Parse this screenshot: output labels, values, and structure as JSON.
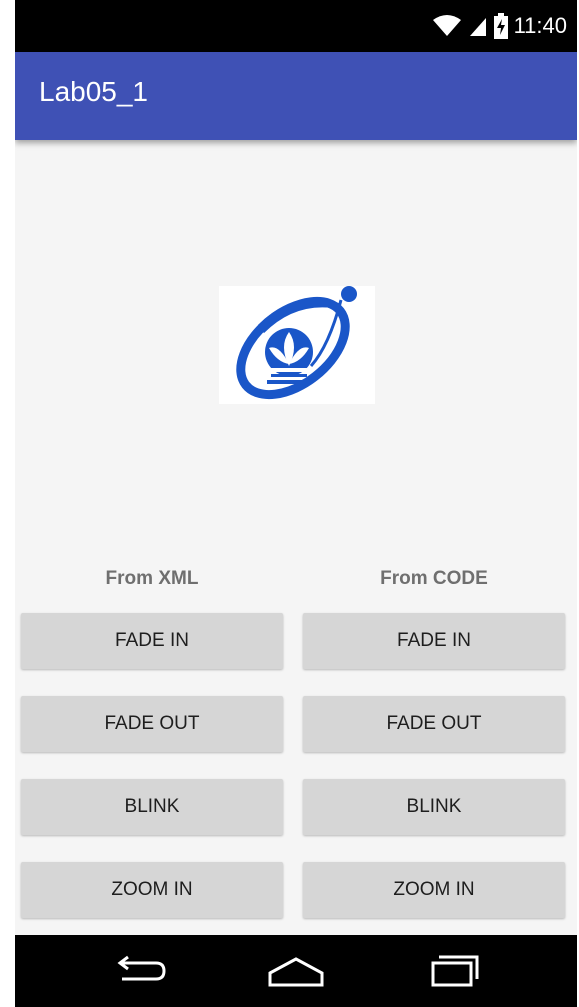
{
  "status_bar": {
    "time": "11:40",
    "icons": [
      "wifi-icon",
      "cell-signal-icon",
      "battery-charging-icon"
    ]
  },
  "app_bar": {
    "title": "Lab05_1",
    "color": "#3f51b5"
  },
  "logo": {
    "icon": "university-logo-icon",
    "color": "#1a56c8"
  },
  "columns": {
    "left": {
      "label": "From XML",
      "buttons": [
        "FADE IN",
        "FADE OUT",
        "BLINK",
        "ZOOM IN"
      ]
    },
    "right": {
      "label": "From CODE",
      "buttons": [
        "FADE IN",
        "FADE OUT",
        "BLINK",
        "ZOOM IN"
      ]
    }
  },
  "nav_bar": {
    "icons": [
      "back-icon",
      "home-icon",
      "recents-icon"
    ]
  }
}
